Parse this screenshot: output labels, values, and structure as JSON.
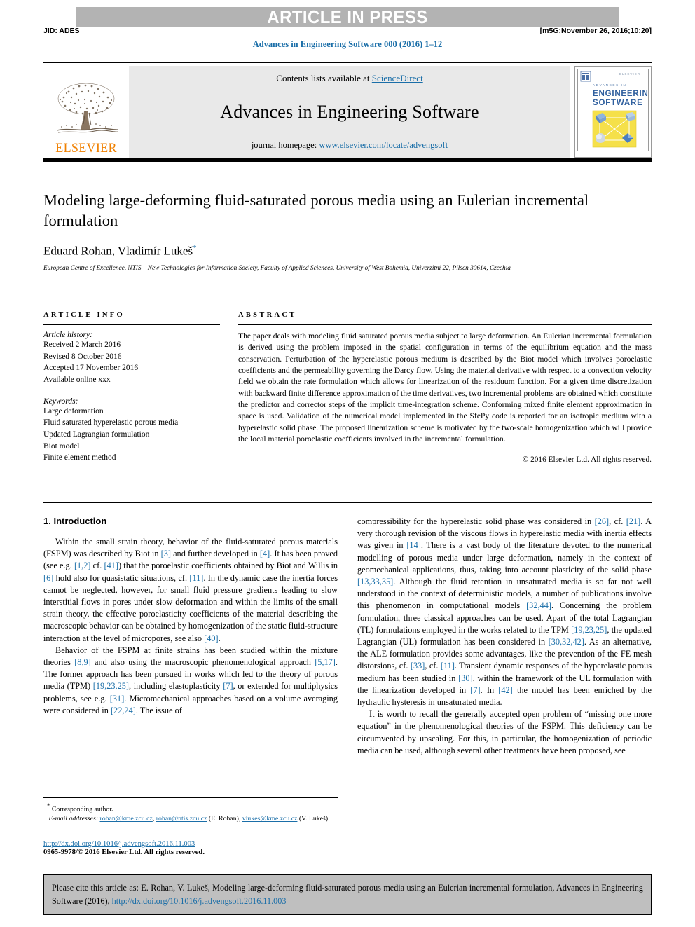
{
  "banner": {
    "text": "ARTICLE IN PRESS"
  },
  "header": {
    "jid": "JID: ADES",
    "stamp": "[m5G;November 26, 2016;10:20]",
    "running_head": "Advances in Engineering Software 000 (2016) 1–12"
  },
  "masthead": {
    "contents_prefix": "Contents lists available at ",
    "sciencedirect": "ScienceDirect",
    "journal_title": "Advances in Engineering Software",
    "homepage_prefix": "journal homepage: ",
    "homepage_url": "www.elsevier.com/locate/advengsoft",
    "publisher_wordmark": "ELSEVIER",
    "cover": {
      "kicker": "ADVANCES IN",
      "line1": "ENGINEERING",
      "line2": "SOFTWARE"
    }
  },
  "article": {
    "title": "Modeling large-deforming fluid-saturated porous media using an Eulerian incremental formulation",
    "authors": "Eduard Rohan, Vladimír Lukeš",
    "author_marker": "*",
    "affiliation": "European Centre of Excellence, NTIS – New Technologies for Information Society, Faculty of Applied Sciences, University of West Bohemia, Univerzitní 22, Pilsen 30614, Czechia"
  },
  "info": {
    "label": "ARTICLE INFO",
    "history_label": "Article history:",
    "history": [
      "Received 2 March 2016",
      "Revised 8 October 2016",
      "Accepted 17 November 2016",
      "Available online xxx"
    ],
    "keywords_label": "Keywords:",
    "keywords": [
      "Large deformation",
      "Fluid saturated hyperelastic porous media",
      "Updated Lagrangian formulation",
      "Biot model",
      "Finite element method"
    ]
  },
  "abstract": {
    "label": "ABSTRACT",
    "text": "The paper deals with modeling fluid saturated porous media subject to large deformation. An Eulerian incremental formulation is derived using the problem imposed in the spatial configuration in terms of the equilibrium equation and the mass conservation. Perturbation of the hyperelastic porous medium is described by the Biot model which involves poroelastic coefficients and the permeability governing the Darcy flow. Using the material derivative with respect to a convection velocity field we obtain the rate formulation which allows for linearization of the residuum function. For a given time discretization with backward finite difference approximation of the time derivatives, two incremental problems are obtained which constitute the predictor and corrector steps of the implicit time-integration scheme. Conforming mixed finite element approximation in space is used. Validation of the numerical model implemented in the SfePy code is reported for an isotropic medium with a hyperelastic solid phase. The proposed linearization scheme is motivated by the two-scale homogenization which will provide the local material poroelastic coefficients involved in the incremental formulation.",
    "copyright": "© 2016 Elsevier Ltd. All rights reserved."
  },
  "body": {
    "section_title": "1. Introduction",
    "left_paragraphs": [
      "Within the small strain theory, behavior of the fluid-saturated porous materials (FSPM) was described by Biot in [3] and further developed in [4]. It has been proved (see e.g. [1,2] cf. [41]) that the poroelastic coefficients obtained by Biot and Willis in [6] hold also for quasistatic situations, cf. [11]. In the dynamic case the inertia forces cannot be neglected, however, for small fluid pressure gradients leading to slow interstitial flows in pores under slow deformation and within the limits of the small strain theory, the effective poroelasticity coefficients of the material describing the macroscopic behavior can be obtained by homogenization of the static fluid-structure interaction at the level of micropores, see also [40].",
      "Behavior of the FSPM at finite strains has been studied within the mixture theories [8,9] and also using the macroscopic phenomenological approach [5,17]. The former approach has been pursued in works which led to the theory of porous media (TPM) [19,23,25], including elastoplasticity [7], or extended for multiphysics problems, see e.g. [31]. Micromechanical approaches based on a volume averaging were considered in [22,24]. The issue of"
    ],
    "right_paragraphs": [
      "compressibility for the hyperelastic solid phase was considered in [26], cf. [21]. A very thorough revision of the viscous flows in hyperelastic media with inertia effects was given in [14]. There is a vast body of the literature devoted to the numerical modelling of porous media under large deformation, namely in the context of geomechanical applications, thus, taking into account plasticity of the solid phase [13,33,35]. Although the fluid retention in unsaturated media is so far not well understood in the context of deterministic models, a number of publications involve this phenomenon in computational models [32,44]. Concerning the problem formulation, three classical approaches can be used. Apart of the total Lagrangian (TL) formulations employed in the works related to the TPM [19,23,25], the updated Lagrangian (UL) formulation has been considered in [30,32,42]. As an alternative, the ALE formulation provides some advantages, like the prevention of the FE mesh distorsions, cf. [33], cf. [11]. Transient dynamic responses of the hyperelastic porous medium has been studied in [30], within the framework of the UL formulation with the linearization developed in [7]. In [42] the model has been enriched by the hydraulic hysteresis in unsaturated media.",
      "It is worth to recall the generally accepted open problem of “missing one more equation” in the phenomenological theories of the FSPM. This deficiency can be circumvented by upscaling. For this, in particular, the homogenization of periodic media can be used, although several other treatments have been proposed, see"
    ]
  },
  "footnote": {
    "corresponding": "Corresponding author.",
    "email_label": "E-mail addresses:",
    "email1": "rohan@kme.zcu.cz",
    "email2": "rohan@ntis.zcu.cz",
    "email1_owner": "(E. Rohan),",
    "email3": "vlukes@kme.zcu.cz",
    "email3_owner": "(V. Lukeš).",
    "doi": "http://dx.doi.org/10.1016/j.advengsoft.2016.11.003",
    "issn": "0965-9978/© 2016 Elsevier Ltd. All rights reserved."
  },
  "cite_box": {
    "text_before": "Please cite this article as: E. Rohan, V. Lukeš, Modeling large-deforming fluid-saturated porous media using an Eulerian incremental formulation, Advances in Engineering Software (2016), ",
    "link": "http://dx.doi.org/10.1016/j.advengsoft.2016.11.003"
  },
  "colors": {
    "link": "#1a6ea8",
    "banner_bg": "#b3b3b3",
    "cite_bg": "#bfbfbf",
    "elsevier_orange": "#f08000"
  }
}
